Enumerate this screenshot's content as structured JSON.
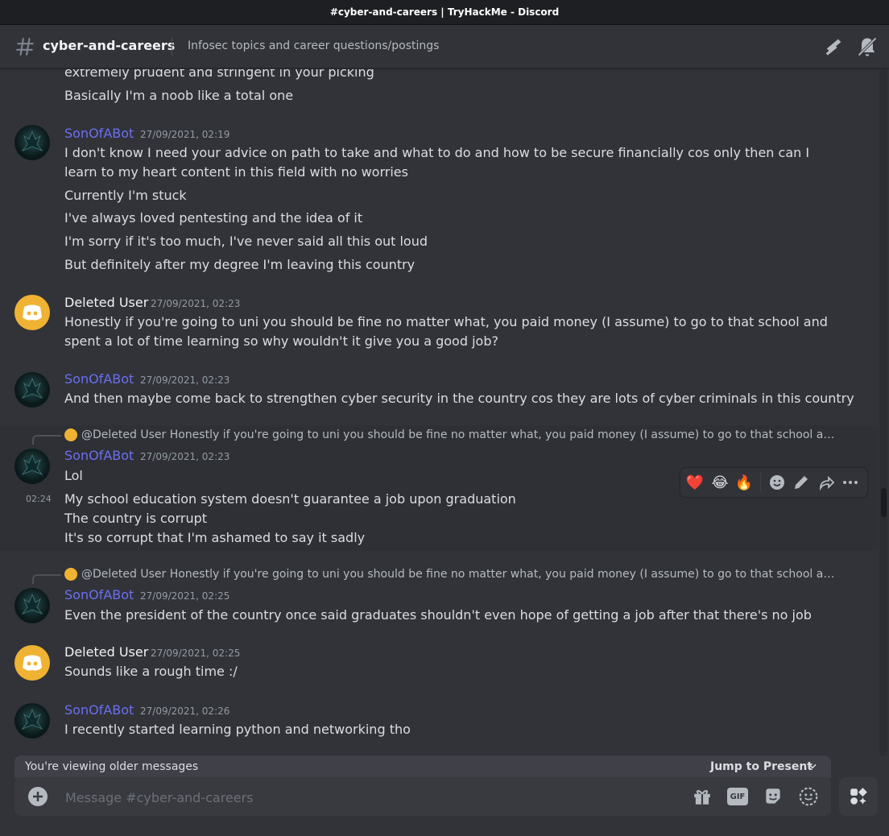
{
  "window": {
    "title": "#cyber-and-careers | TryHackMe - Discord"
  },
  "header": {
    "channel_name": "cyber-and-careers",
    "topic": "Infosec topics and career questions/postings"
  },
  "messages": {
    "prev_lines": [
      "extremely prudent and stringent in your picking",
      "Basically I'm a noob like a total one"
    ],
    "m1": {
      "author": "SonOfABot",
      "timestamp": "27/09/2021, 02:19",
      "lines": [
        "I don't know I need your advice on path to take and what to do and how to be secure financially cos only then can I learn to my heart content in this field with no worries",
        "Currently I'm stuck",
        "I've always loved pentesting and the idea of it",
        "I'm sorry if it's too much, I've never said all this out loud",
        "But definitely after my degree I'm leaving this country"
      ]
    },
    "m2": {
      "author": "Deleted User",
      "timestamp": "27/09/2021, 02:23",
      "lines": [
        "Honestly if you're going to uni you should be fine no matter what, you paid money (I assume) to go to that school and spent a lot of time learning so why wouldn't it give you a good job?"
      ]
    },
    "m3": {
      "author": "SonOfABot",
      "timestamp": "27/09/2021, 02:23",
      "lines": [
        "And then maybe come back to strengthen cyber security in the country cos they are lots of cyber criminals in this country"
      ]
    },
    "m4": {
      "reply_name": "@Deleted User",
      "reply_text": "Honestly if you're going to uni you should be fine no matter what, you paid money (I assume) to go to that school and spent a lo...",
      "author": "SonOfABot",
      "timestamp": "27/09/2021, 02:23",
      "lines": [
        "Lol"
      ],
      "hover_time": "02:24",
      "cont_lines": [
        "My school education system doesn't guarantee a job upon graduation",
        "The country is corrupt",
        "It's so corrupt that I'm ashamed to say it sadly"
      ]
    },
    "m5": {
      "reply_name": "@Deleted User",
      "reply_text": "Honestly if you're going to uni you should be fine no matter what, you paid money (I assume) to go to that school and spent a lo...",
      "author": "SonOfABot",
      "timestamp": "27/09/2021, 02:25",
      "lines": [
        "Even the president of the country once said graduates shouldn't even hope of getting a job after that there's no job"
      ]
    },
    "m6": {
      "author": "Deleted User",
      "timestamp": "27/09/2021, 02:25",
      "lines": [
        "Sounds like a rough time :/"
      ]
    },
    "m7": {
      "author": "SonOfABot",
      "timestamp": "27/09/2021, 02:26",
      "lines": [
        "I recently started learning python and networking tho"
      ]
    }
  },
  "reactions_toolbar": {
    "emojis": [
      "❤️",
      "😂",
      "🔥"
    ],
    "icons": [
      "add-reaction-icon",
      "edit-icon",
      "forward-icon",
      "more-icon"
    ]
  },
  "older_bar": {
    "text": "You're viewing older messages",
    "jump_label": "Jump to Present"
  },
  "composer": {
    "placeholder": "Message #cyber-and-careers",
    "icons": [
      "gift-icon",
      "gif-icon",
      "sticker-icon",
      "emoji-icon",
      "apps-icon"
    ],
    "gif_label": "GIF"
  },
  "colors": {
    "background": "#313338",
    "username_bot": "#6c6ff2",
    "deleted_avatar": "#f0b232",
    "text": "#dbdee1"
  }
}
